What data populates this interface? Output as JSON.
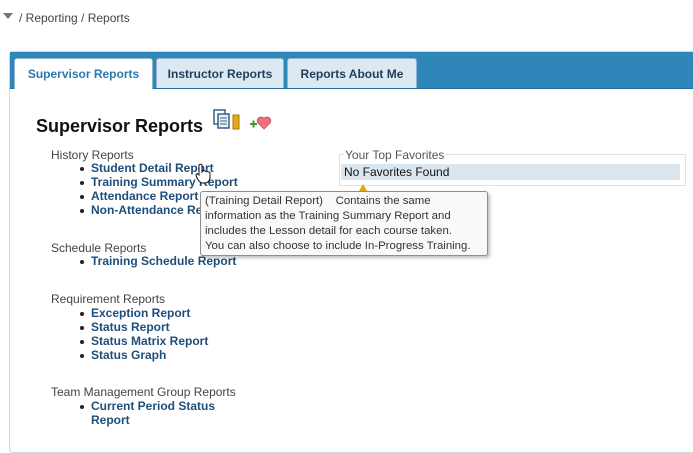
{
  "breadcrumb": {
    "text": "/ Reporting / Reports"
  },
  "tabs": [
    {
      "label": "Supervisor Reports",
      "active": true
    },
    {
      "label": "Instructor Reports",
      "active": false
    },
    {
      "label": "Reports About Me",
      "active": false
    }
  ],
  "page_title": "Supervisor Reports",
  "icons": {
    "copy": "copy-report-icon",
    "favorite": "add-favorite-icon"
  },
  "sections": [
    {
      "heading": "History Reports",
      "links": [
        "Student Detail Report",
        "Training Summary Report",
        "Attendance Report",
        "Non-Attendance Report"
      ]
    },
    {
      "heading": "Schedule Reports",
      "links": [
        "Training Schedule Report"
      ]
    },
    {
      "heading": "Requirement Reports",
      "links": [
        "Exception Report",
        "Status Report",
        "Status Matrix Report",
        "Status Graph"
      ]
    },
    {
      "heading": "Team Management Group Reports",
      "links": [
        "Current Period Status",
        "Report"
      ]
    }
  ],
  "favorites": {
    "title": "Your Top Favorites",
    "empty_text": "No Favorites Found"
  },
  "tooltip": {
    "lines": [
      "(Training Detail Report)    Contains the same",
      "information as the Training Summary Report and",
      "includes the Lesson detail for each course taken.",
      "You can also choose to include In-Progress Training."
    ]
  },
  "colors": {
    "tab_bar": "#2f86b8",
    "link": "#1e4e7a",
    "favorites_row": "#dce6ee",
    "tooltip_arrow": "#e3a41c"
  }
}
